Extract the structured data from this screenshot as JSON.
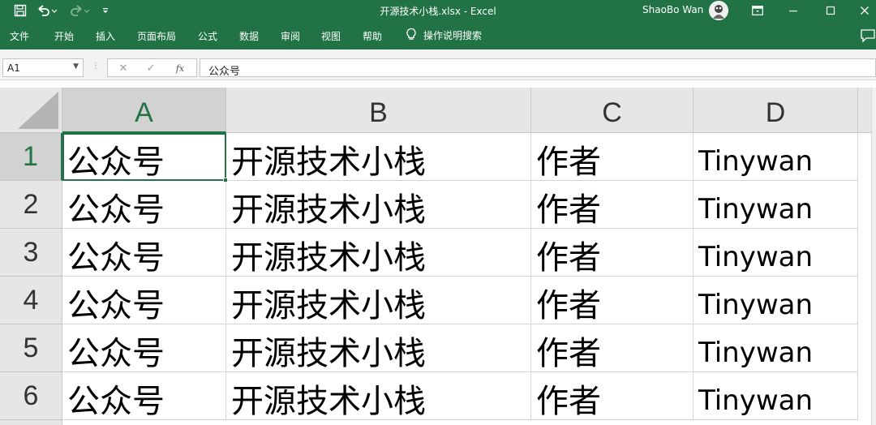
{
  "window": {
    "title": "开源技术小栈.xlsx  -  Excel",
    "user_name": "ShaoBo Wan",
    "accent_color": "#217346"
  },
  "quick_access": {
    "icons": [
      "save-icon",
      "undo-icon",
      "redo-icon",
      "customize-icon"
    ]
  },
  "ribbon": {
    "tabs": [
      "文件",
      "开始",
      "插入",
      "页面布局",
      "公式",
      "数据",
      "审阅",
      "视图",
      "帮助"
    ],
    "tell_me": "操作说明搜索"
  },
  "formula_bar": {
    "name_box": "A1",
    "formula": "公众号",
    "fx_label": "fx"
  },
  "sheet": {
    "columns": [
      "A",
      "B",
      "C",
      "D"
    ],
    "rows": [
      {
        "number": "1",
        "cells": [
          "公众号",
          "开源技术小栈",
          "作者",
          "Tinywan"
        ]
      },
      {
        "number": "2",
        "cells": [
          "公众号",
          "开源技术小栈",
          "作者",
          "Tinywan"
        ]
      },
      {
        "number": "3",
        "cells": [
          "公众号",
          "开源技术小栈",
          "作者",
          "Tinywan"
        ]
      },
      {
        "number": "4",
        "cells": [
          "公众号",
          "开源技术小栈",
          "作者",
          "Tinywan"
        ]
      },
      {
        "number": "5",
        "cells": [
          "公众号",
          "开源技术小栈",
          "作者",
          "Tinywan"
        ]
      },
      {
        "number": "6",
        "cells": [
          "公众号",
          "开源技术小栈",
          "作者",
          "Tinywan"
        ]
      }
    ],
    "active_cell": "A1"
  }
}
